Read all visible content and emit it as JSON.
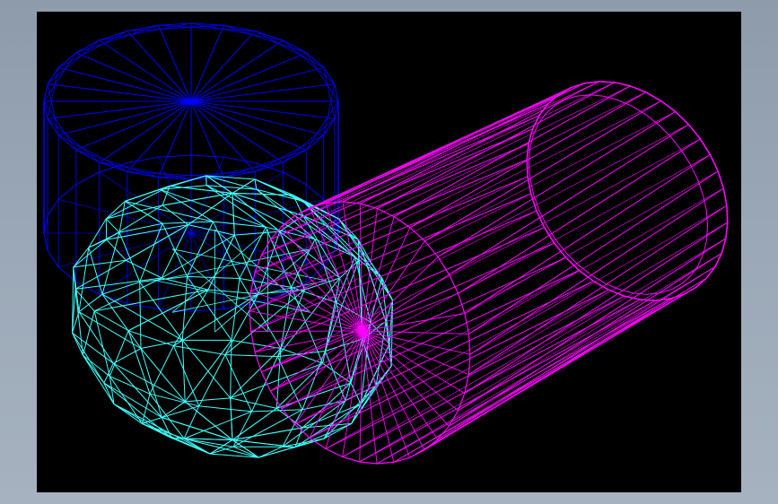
{
  "viewport": {
    "background": "#000000",
    "render_mode": "wireframe",
    "window_background": "#9aa7b6"
  },
  "scene": {
    "objects": [
      {
        "name": "cylinder",
        "color": "#0000ff"
      },
      {
        "name": "geodesic-sphere",
        "color": "#3fffff"
      },
      {
        "name": "tilted-cylinder",
        "color": "#ff00ff"
      }
    ]
  }
}
